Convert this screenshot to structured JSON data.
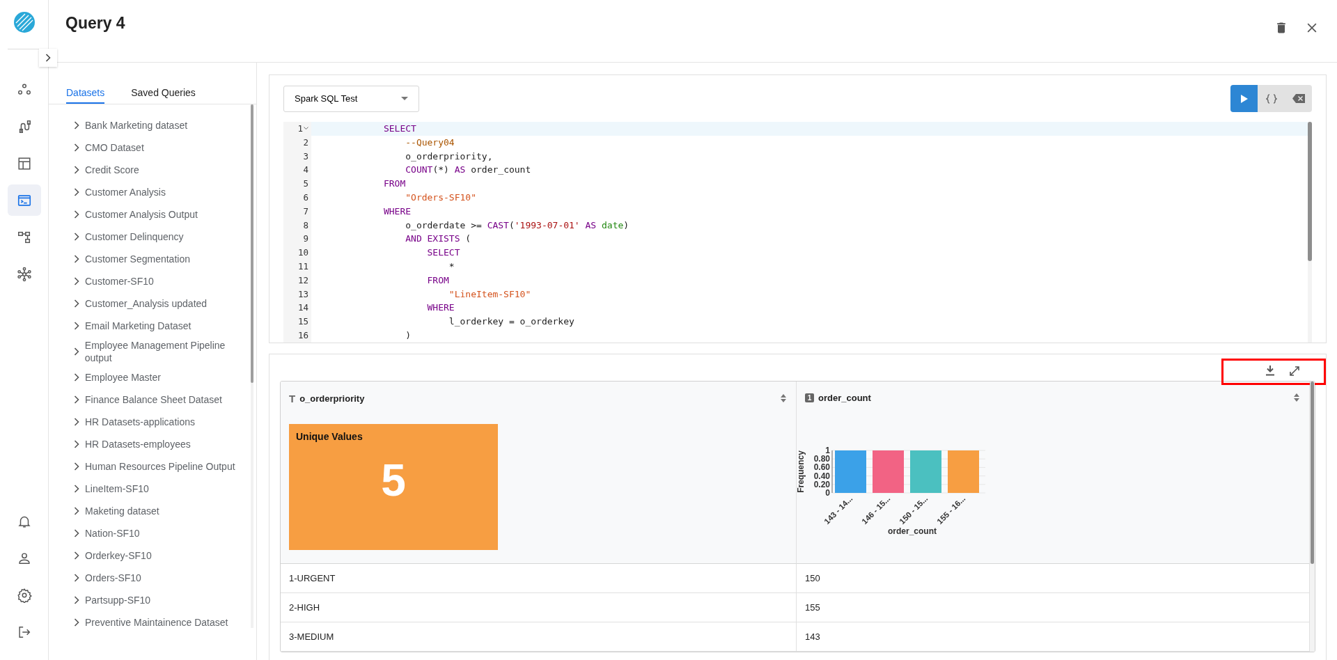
{
  "rail": {
    "nav": [
      {
        "kind": "nodes",
        "selected": false
      },
      {
        "kind": "pipeline",
        "selected": false
      },
      {
        "kind": "table",
        "selected": false
      },
      {
        "kind": "terminal",
        "selected": true
      },
      {
        "kind": "hierarchy",
        "selected": false
      },
      {
        "kind": "network",
        "selected": false
      }
    ],
    "bottom": [
      {
        "kind": "bell"
      },
      {
        "kind": "user"
      },
      {
        "kind": "gear"
      },
      {
        "kind": "logout"
      }
    ]
  },
  "header": {
    "title": "Query 4"
  },
  "sidebar": {
    "tabs": [
      {
        "label": "Datasets",
        "selected": true
      },
      {
        "label": "Saved Queries",
        "selected": false
      }
    ],
    "items": [
      {
        "label": "Bank Marketing dataset"
      },
      {
        "label": "CMO Dataset"
      },
      {
        "label": "Credit Score"
      },
      {
        "label": "Customer Analysis"
      },
      {
        "label": "Customer Analysis Output"
      },
      {
        "label": "Customer Delinquency"
      },
      {
        "label": "Customer Segmentation"
      },
      {
        "label": "Customer-SF10"
      },
      {
        "label": "Customer_Analysis updated"
      },
      {
        "label": "Email Marketing Dataset"
      },
      {
        "label": "Employee Management Pipeline output"
      },
      {
        "label": "Employee Master"
      },
      {
        "label": "Finance Balance Sheet Dataset"
      },
      {
        "label": "HR Datasets-applications"
      },
      {
        "label": "HR Datasets-employees"
      },
      {
        "label": "Human Resources Pipeline Output"
      },
      {
        "label": "LineItem-SF10"
      },
      {
        "label": "Maketing dataset"
      },
      {
        "label": "Nation-SF10"
      },
      {
        "label": "Orderkey-SF10"
      },
      {
        "label": "Orders-SF10"
      },
      {
        "label": "Partsupp-SF10"
      },
      {
        "label": "Preventive Maintainence Dataset"
      }
    ]
  },
  "editor": {
    "engine": "Spark SQL Test",
    "lines": [
      {
        "number": "1",
        "active": true,
        "segments": [
          {
            "kind": "keyword",
            "text": "            SELECT"
          }
        ]
      },
      {
        "number": "2",
        "active": false,
        "segments": [
          {
            "kind": "comment",
            "text": "                --Query04"
          }
        ]
      },
      {
        "number": "3",
        "active": false,
        "segments": [
          {
            "kind": "plain",
            "text": "                o_orderpriority,"
          }
        ]
      },
      {
        "number": "4",
        "active": false,
        "segments": [
          {
            "kind": "keyword",
            "text": "                COUNT"
          },
          {
            "kind": "plain",
            "text": "(*) "
          },
          {
            "kind": "keyword",
            "text": "AS"
          },
          {
            "kind": "plain",
            "text": " order_count"
          }
        ]
      },
      {
        "number": "5",
        "active": false,
        "segments": [
          {
            "kind": "keyword",
            "text": "            FROM"
          }
        ]
      },
      {
        "number": "6",
        "active": false,
        "segments": [
          {
            "kind": "ident",
            "text": "                \"Orders-SF10\""
          }
        ]
      },
      {
        "number": "7",
        "active": false,
        "segments": [
          {
            "kind": "keyword",
            "text": "            WHERE"
          }
        ]
      },
      {
        "number": "8",
        "active": false,
        "segments": [
          {
            "kind": "plain",
            "text": "                o_orderdate >= "
          },
          {
            "kind": "keyword",
            "text": "CAST"
          },
          {
            "kind": "plain",
            "text": "("
          },
          {
            "kind": "string",
            "text": "'1993-07-01'"
          },
          {
            "kind": "keyword",
            "text": " AS"
          },
          {
            "kind": "type",
            "text": " date"
          },
          {
            "kind": "plain",
            "text": ")"
          }
        ]
      },
      {
        "number": "9",
        "active": false,
        "segments": [
          {
            "kind": "keyword",
            "text": "                AND EXISTS"
          },
          {
            "kind": "plain",
            "text": " ("
          }
        ]
      },
      {
        "number": "10",
        "active": false,
        "segments": [
          {
            "kind": "keyword",
            "text": "                    SELECT"
          }
        ]
      },
      {
        "number": "11",
        "active": false,
        "segments": [
          {
            "kind": "plain",
            "text": "                        *"
          }
        ]
      },
      {
        "number": "12",
        "active": false,
        "segments": [
          {
            "kind": "keyword",
            "text": "                    FROM"
          }
        ]
      },
      {
        "number": "13",
        "active": false,
        "segments": [
          {
            "kind": "ident",
            "text": "                        \"LineItem-SF10\""
          }
        ]
      },
      {
        "number": "14",
        "active": false,
        "segments": [
          {
            "kind": "keyword",
            "text": "                    WHERE"
          }
        ]
      },
      {
        "number": "15",
        "active": false,
        "segments": [
          {
            "kind": "plain",
            "text": "                        l_orderkey = o_orderkey"
          }
        ]
      },
      {
        "number": "16",
        "active": false,
        "segments": [
          {
            "kind": "plain",
            "text": "                )"
          }
        ]
      }
    ]
  },
  "results": {
    "columns": [
      {
        "kind": "text",
        "type_mark": "T",
        "name": "o_orderpriority",
        "summary": {
          "kind": "unique",
          "title": "Unique Values",
          "value": "5"
        }
      },
      {
        "kind": "number",
        "type_mark": "1",
        "name": "order_count",
        "summary": {
          "kind": "histogram",
          "chart_data": {
            "type": "bar",
            "xlabel": "order_count",
            "ylabel": "Frequency",
            "categories": [
              "143 - 14...",
              "146 - 15...",
              "150 - 15...",
              "155 - 16..."
            ],
            "colors": [
              "#3ba1e8",
              "#f26384",
              "#4bc0c0",
              "#f79e42"
            ],
            "series": [
              {
                "values": [
                  1,
                  1,
                  1,
                  1
                ]
              }
            ],
            "grid": true,
            "ylim": [
              0,
              1
            ],
            "yticks": [
              {
                "value": 0,
                "label": "0"
              },
              {
                "value": 0.2,
                "label": "0.20"
              },
              {
                "value": 0.4,
                "label": "0.40"
              },
              {
                "value": 0.6,
                "label": "0.60"
              },
              {
                "value": 0.8,
                "label": "0.80"
              },
              {
                "value": 1,
                "label": "1"
              }
            ]
          }
        }
      }
    ],
    "rows": [
      [
        "1-URGENT",
        "150"
      ],
      [
        "2-HIGH",
        "155"
      ],
      [
        "3-MEDIUM",
        "143"
      ]
    ]
  }
}
